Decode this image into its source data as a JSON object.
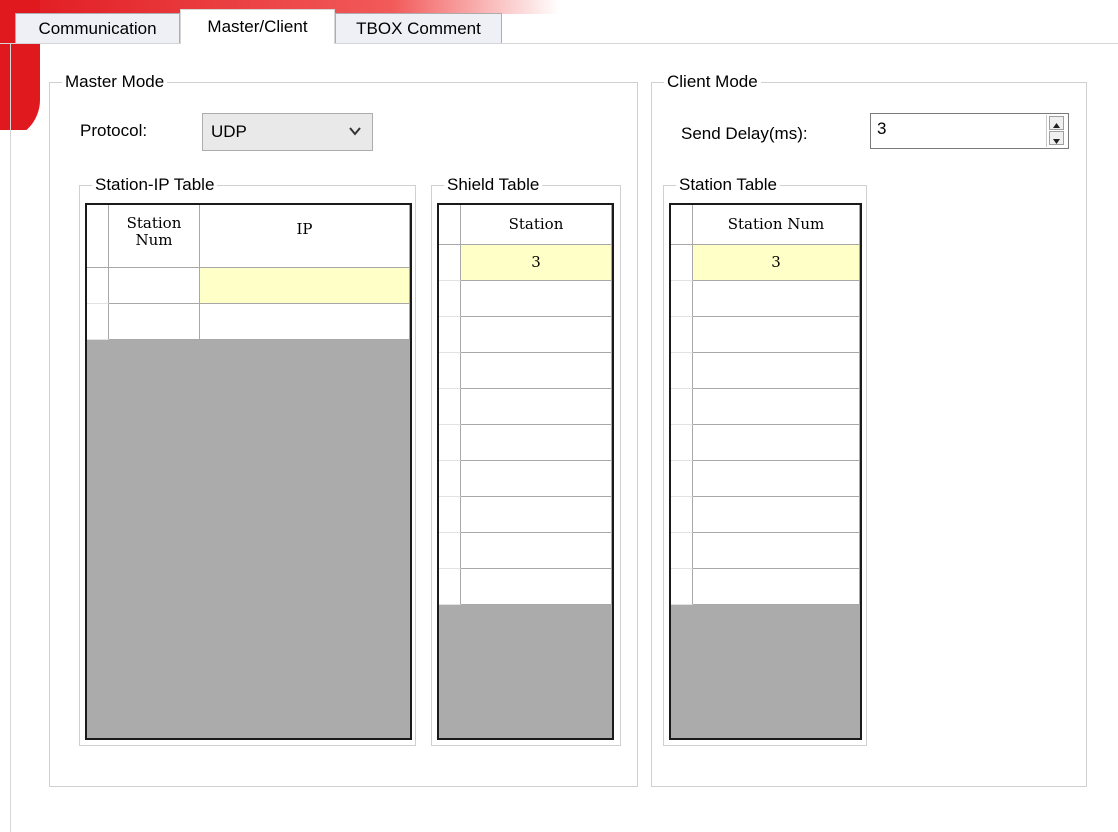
{
  "tabs": [
    {
      "label": "Communication",
      "active": false
    },
    {
      "label": "Master/Client",
      "active": true
    },
    {
      "label": "TBOX Comment",
      "active": false
    }
  ],
  "master_mode": {
    "title": "Master Mode",
    "protocol_label": "Protocol:",
    "protocol_value": "UDP",
    "station_ip_table": {
      "title": "Station-IP Table",
      "headers": [
        "Station Num",
        "IP"
      ],
      "rows": [
        [
          "",
          ""
        ],
        [
          "",
          ""
        ]
      ]
    },
    "shield_table": {
      "title": "Shield Table",
      "header": "Station",
      "rows": [
        "3",
        "",
        "",
        "",
        "",
        "",
        "",
        "",
        "",
        ""
      ]
    }
  },
  "client_mode": {
    "title": "Client Mode",
    "send_delay_label": "Send Delay(ms):",
    "send_delay_value": "3",
    "station_table": {
      "title": "Station Table",
      "header": "Station Num",
      "rows": [
        "3",
        "",
        "",
        "",
        "",
        "",
        "",
        "",
        "",
        ""
      ]
    }
  },
  "colors": {
    "brand": "#e0191f",
    "selected_cell": "#ffffc8",
    "grid_empty": "#ababab"
  }
}
